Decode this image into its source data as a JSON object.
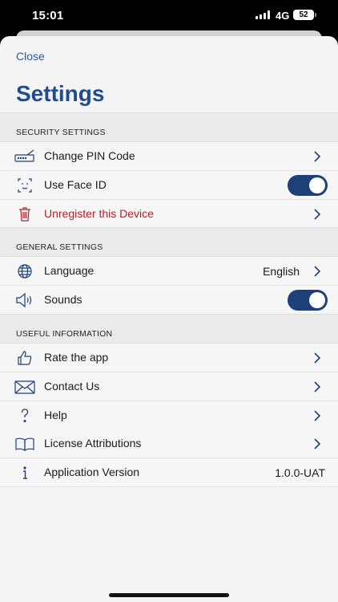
{
  "status_bar": {
    "time": "15:01",
    "network": "4G",
    "battery": "52"
  },
  "header": {
    "close_label": "Close",
    "title": "Settings"
  },
  "sections": {
    "security": {
      "title": "SECURITY SETTINGS",
      "change_pin": "Change PIN Code",
      "face_id": "Use Face ID",
      "face_id_enabled": true,
      "unregister": "Unregister this Device"
    },
    "general": {
      "title": "GENERAL SETTINGS",
      "language": "Language",
      "language_value": "English",
      "sounds": "Sounds",
      "sounds_enabled": true
    },
    "info": {
      "title": "USEFUL INFORMATION",
      "rate": "Rate the app",
      "contact": "Contact Us",
      "help": "Help",
      "license": "License Attributions",
      "version_label": "Application Version",
      "version_value": "1.0.0-UAT"
    }
  },
  "colors": {
    "accent": "#1e4b92",
    "danger": "#b4202a",
    "toggle_on": "#1f3f78"
  },
  "icons": [
    "keyboard-icon",
    "face-id-icon",
    "trash-icon",
    "globe-icon",
    "speaker-icon",
    "thumbs-up-icon",
    "envelope-icon",
    "question-icon",
    "book-icon",
    "info-icon",
    "chevron-right-icon"
  ]
}
